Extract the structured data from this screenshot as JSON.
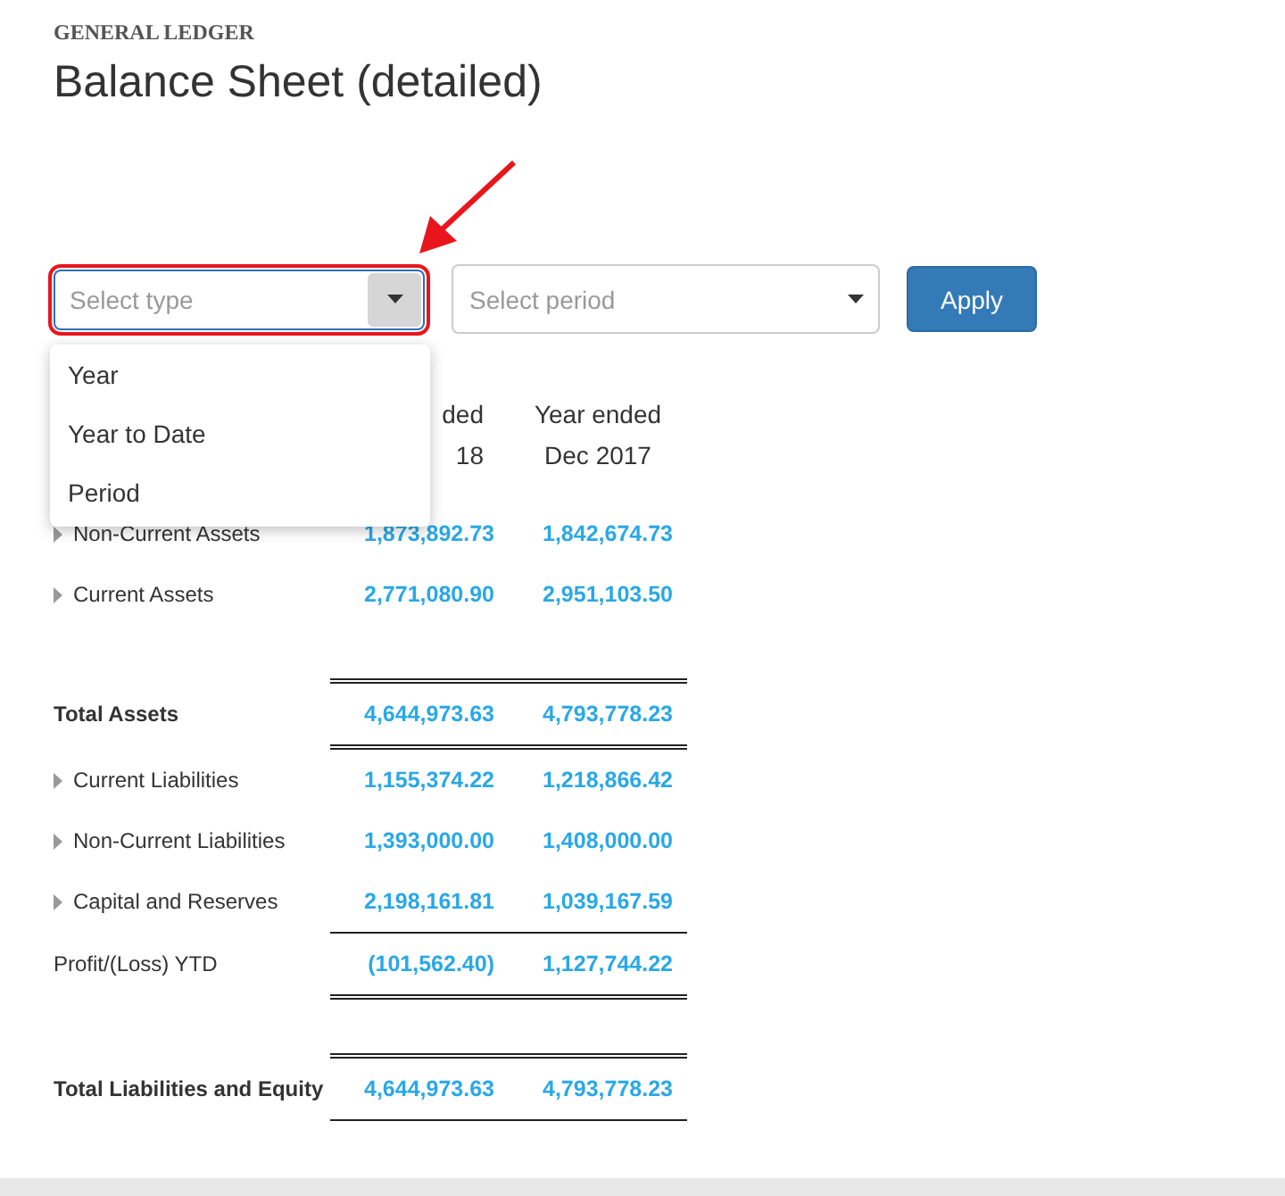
{
  "breadcrumb": "GENERAL LEDGER",
  "title": "Balance Sheet (detailed)",
  "type_select": {
    "placeholder": "Select type",
    "highlighted": true,
    "open": true,
    "options": [
      {
        "label": "Year"
      },
      {
        "label": "Year to Date"
      },
      {
        "label": "Period"
      }
    ]
  },
  "period_select": {
    "placeholder": "Select period"
  },
  "apply_button": "Apply",
  "table": {
    "column_headers": [
      [
        "ded",
        "18"
      ],
      [
        "Year ended",
        "Dec 2017"
      ]
    ],
    "rows": [
      {
        "kind": "group",
        "label": "Non-Current Assets",
        "values": [
          "1,873,892.73",
          "1,842,674.73"
        ]
      },
      {
        "kind": "group",
        "label": "Current Assets",
        "values": [
          "2,771,080.90",
          "2,951,103.50"
        ]
      },
      {
        "kind": "gap"
      },
      {
        "kind": "rule",
        "double": true
      },
      {
        "kind": "total",
        "label": "Total Assets",
        "values": [
          "4,644,973.63",
          "4,793,778.23"
        ]
      },
      {
        "kind": "rule",
        "double": true
      },
      {
        "kind": "group",
        "label": "Current Liabilities",
        "values": [
          "1,155,374.22",
          "1,218,866.42"
        ]
      },
      {
        "kind": "group",
        "label": "Non-Current Liabilities",
        "values": [
          "1,393,000.00",
          "1,408,000.00"
        ]
      },
      {
        "kind": "group",
        "label": "Capital and Reserves",
        "values": [
          "2,198,161.81",
          "1,039,167.59"
        ]
      },
      {
        "kind": "rule",
        "double": false
      },
      {
        "kind": "plain",
        "label": "Profit/(Loss) YTD",
        "values": [
          "(101,562.40)",
          "1,127,744.22"
        ]
      },
      {
        "kind": "rule",
        "double": true
      },
      {
        "kind": "gap"
      },
      {
        "kind": "rule",
        "double": true
      },
      {
        "kind": "total",
        "label": "Total Liabilities and Equity",
        "values": [
          "4,644,973.63",
          "4,793,778.23"
        ]
      },
      {
        "kind": "rule",
        "double": false
      }
    ]
  }
}
